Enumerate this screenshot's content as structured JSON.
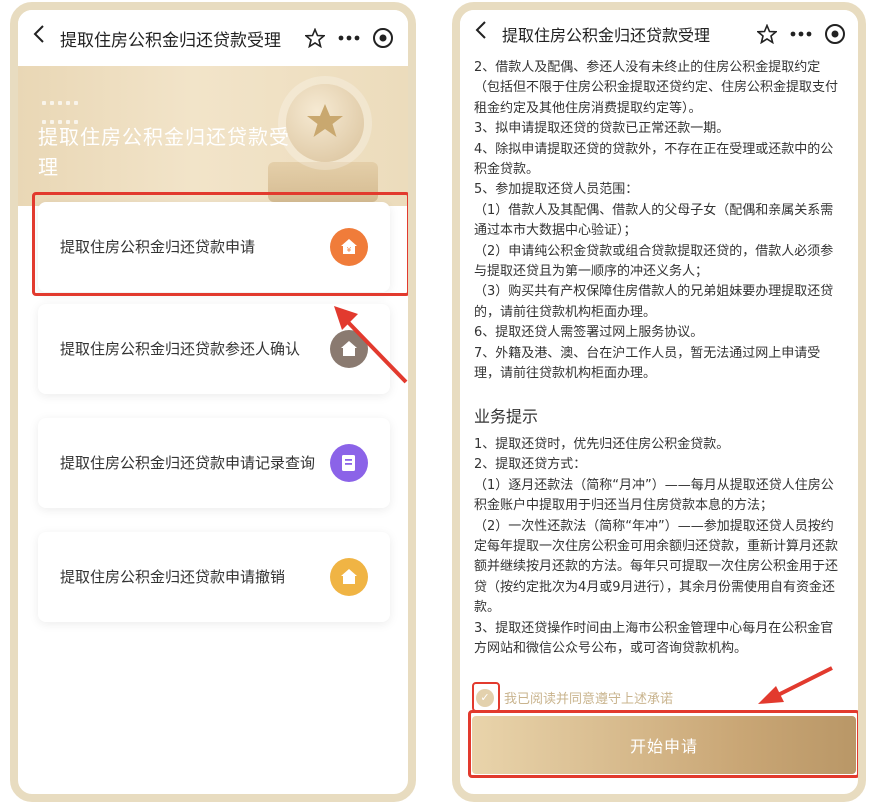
{
  "left": {
    "nav": {
      "title": "提取住房公积金归还贷款受理"
    },
    "banner": {
      "title": "提取住房公积金归还贷款受理"
    },
    "cards": [
      {
        "label": "提取住房公积金归还贷款申请",
        "icon": "house-yen-icon",
        "color": "#f07c3a"
      },
      {
        "label": "提取住房公积金归还贷款参还人确认",
        "icon": "house-user-icon",
        "color": "#8a7a70"
      },
      {
        "label": "提取住房公积金归还贷款申请记录查询",
        "icon": "record-list-icon",
        "color": "#8b63e8"
      },
      {
        "label": "提取住房公积金归还贷款申请撤销",
        "icon": "house-cancel-icon",
        "color": "#f0b444"
      }
    ]
  },
  "right": {
    "nav": {
      "title": "提取住房公积金归还贷款受理"
    },
    "items": [
      "2、借款人及配偶、参还人没有未终止的住房公积金提取约定（包括但不限于住房公积金提取还贷约定、住房公积金提取支付租金约定及其他住房消费提取约定等）。",
      "3、拟申请提取还贷的贷款已正常还款一期。",
      "4、除拟申请提取还贷的贷款外，不存在正在受理或还款中的公积金贷款。",
      "5、参加提取还贷人员范围：",
      "（1）借款人及其配偶、借款人的父母子女（配偶和亲属关系需通过本市大数据中心验证）；",
      "（2）申请纯公积金贷款或组合贷款提取还贷的，借款人必须参与提取还贷且为第一顺序的冲还义务人；",
      "（3）购买共有产权保障住房借款人的兄弟姐妹要办理提取还贷的，请前往贷款机构柜面办理。",
      "6、提取还贷人需签署过网上服务协议。",
      "7、外籍及港、澳、台在沪工作人员，暂无法通过网上申请受理，请前往贷款机构柜面办理。"
    ],
    "tips_title": "业务提示",
    "tips": [
      "1、提取还贷时，优先归还住房公积金贷款。",
      "2、提取还贷方式：",
      "（1）逐月还款法（简称“月冲”）——每月从提取还贷人住房公积金账户中提取用于归还当月住房贷款本息的方法；",
      "（2）一次性还款法（简称“年冲”）——参加提取还贷人员按约定每年提取一次住房公积金可用余额归还贷款，重新计算月还款额并继续按月还款的方法。每年只可提取一次住房公积金用于还贷（按约定批次为4月或9月进行），其余月份需使用自有资金还款。",
      "3、提取还贷操作时间由上海市公积金管理中心每月在公积金官方网站和微信公众号公布，或可咨询贷款机构。"
    ],
    "agree_text": "我已阅读并同意遵守上述承诺",
    "start_button": "开始申请"
  },
  "colors": {
    "highlight": "#e23a2e",
    "gold": "#c9a675"
  }
}
